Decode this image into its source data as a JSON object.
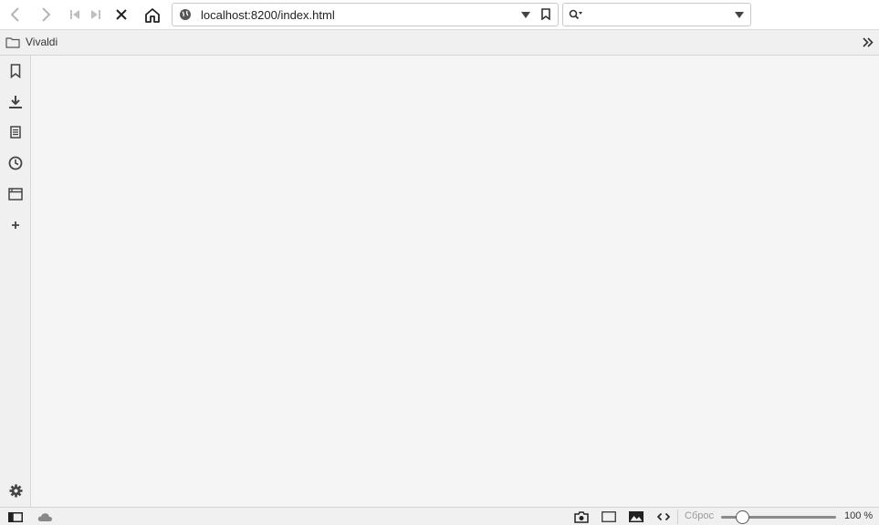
{
  "toolbar": {
    "url": "localhost:8200/index.html",
    "search_placeholder": ""
  },
  "bookmarks_bar": {
    "folder_label": "Vivaldi"
  },
  "sidebar": {
    "items": [
      {
        "icon": "bookmark-icon"
      },
      {
        "icon": "download-icon"
      },
      {
        "icon": "notes-icon"
      },
      {
        "icon": "history-icon"
      },
      {
        "icon": "window-icon"
      },
      {
        "icon": "add-panel-icon"
      }
    ],
    "settings_icon": "gear-icon"
  },
  "statusbar": {
    "reset_label": "Сброс",
    "zoom_level": "100 %",
    "zoom_fraction": 0.19
  },
  "colors": {
    "icon": "#555555",
    "background": "#f5f5f5"
  }
}
